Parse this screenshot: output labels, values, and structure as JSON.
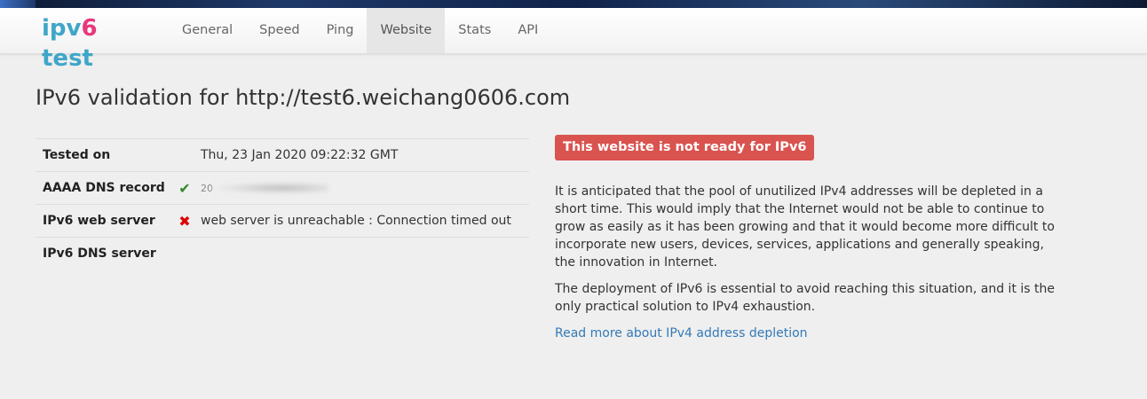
{
  "brand": {
    "prefix": "ipv",
    "six": "6",
    "suffix": " test"
  },
  "nav": {
    "items": [
      {
        "label": "General",
        "active": false
      },
      {
        "label": "Speed",
        "active": false
      },
      {
        "label": "Ping",
        "active": false
      },
      {
        "label": "Website",
        "active": true
      },
      {
        "label": "Stats",
        "active": false
      },
      {
        "label": "API",
        "active": false
      }
    ]
  },
  "page": {
    "title": "IPv6 validation for http://test6.weichang0606.com"
  },
  "results": {
    "rows": [
      {
        "label": "Tested on",
        "icon": "",
        "value": "Thu, 23 Jan 2020 09:22:32 GMT"
      },
      {
        "label": "AAAA DNS record",
        "icon": "check-icon",
        "value": "20"
      },
      {
        "label": "IPv6 web server",
        "icon": "cross-icon",
        "value": "web server is unreachable : Connection timed out"
      },
      {
        "label": "IPv6 DNS server",
        "icon": "",
        "value": ""
      }
    ]
  },
  "status": {
    "alert": "This website is not ready for IPv6",
    "color": "#d9534f"
  },
  "description": {
    "p1": "It is anticipated that the pool of unutilized IPv4 addresses will be depleted in a short time. This would imply that the Internet would not be able to continue to grow as easily as it has been growing and that it would become more difficult to incorporate new users, devices, services, applications and generally speaking, the innovation in Internet.",
    "p2": "The deployment of IPv6 is essential to avoid reaching this situation, and it is the only practical solution to IPv4 exhaustion.",
    "link": "Read more about IPv4 address depletion"
  },
  "colors": {
    "brand_blue": "#3fa6c8",
    "brand_pink": "#e8377c",
    "link": "#337ab7",
    "ok": "#2d8a2d",
    "fail": "#dd0000"
  }
}
